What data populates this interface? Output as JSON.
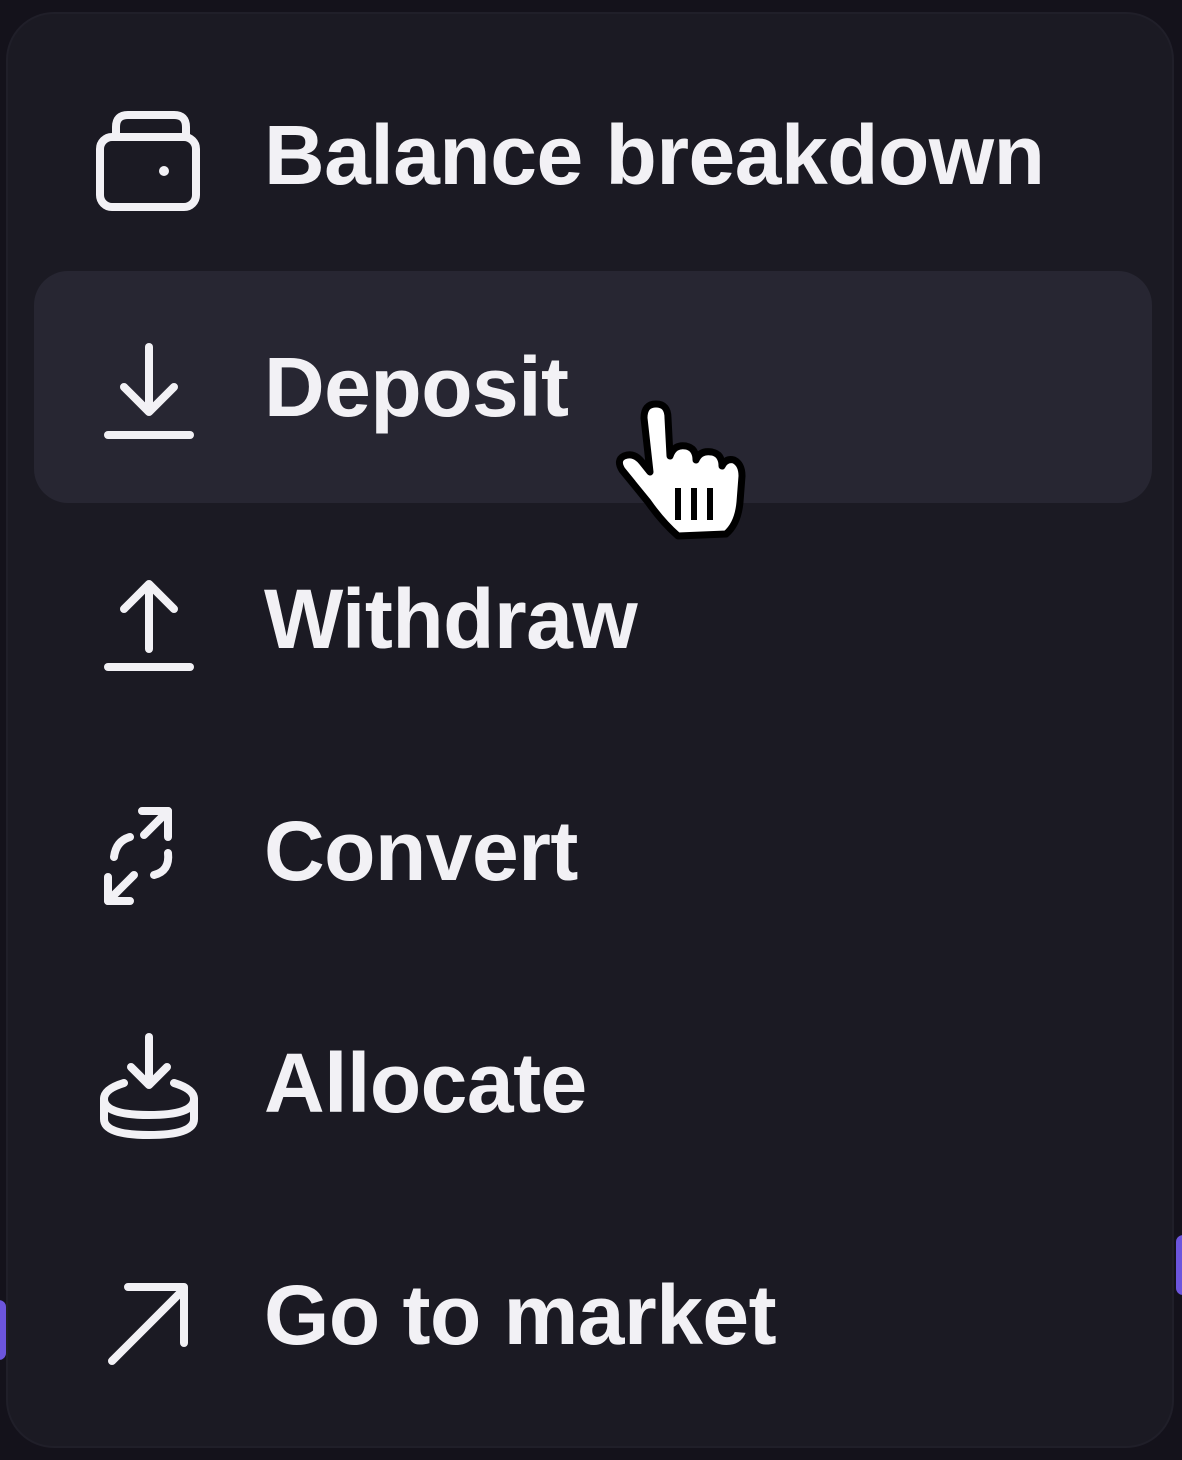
{
  "menu": {
    "items": [
      {
        "label": "Balance breakdown",
        "icon": "wallet-icon"
      },
      {
        "label": "Deposit",
        "icon": "download-icon",
        "hovered": true
      },
      {
        "label": "Withdraw",
        "icon": "upload-icon"
      },
      {
        "label": "Convert",
        "icon": "convert-arrows-icon"
      },
      {
        "label": "Allocate",
        "icon": "allocate-stack-icon"
      },
      {
        "label": "Go to market",
        "icon": "arrow-up-right-icon"
      }
    ]
  },
  "colors": {
    "background": "#14121b",
    "menu_background": "#1b1a23",
    "hover_background": "#272632",
    "text": "#f2f1f5",
    "accent": "#7b61ff"
  }
}
